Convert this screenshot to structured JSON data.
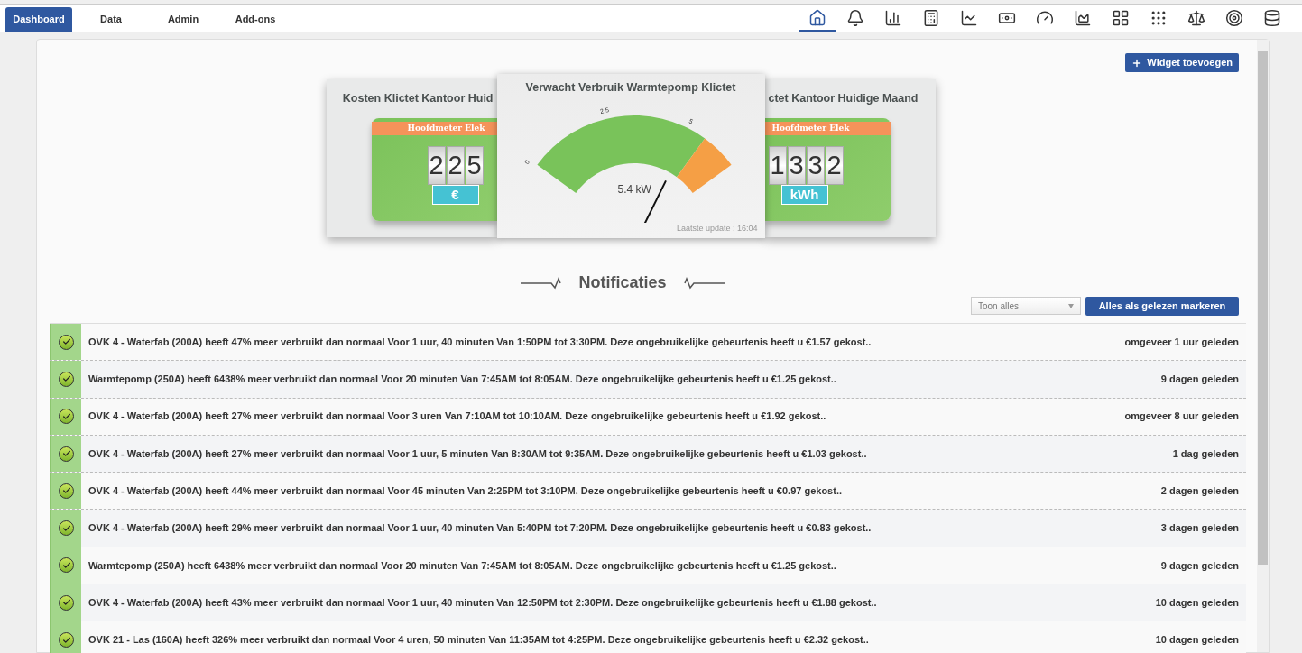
{
  "tabs": [
    {
      "label": "Dashboard",
      "selected": true
    },
    {
      "label": "Data",
      "selected": false
    },
    {
      "label": "Admin",
      "selected": false
    },
    {
      "label": "Add-ons",
      "selected": false
    }
  ],
  "toolbar": [
    {
      "selected": true
    },
    {
      "selected": false
    },
    {
      "selected": false
    },
    {
      "selected": false
    },
    {
      "selected": false
    },
    {
      "selected": false
    },
    {
      "selected": false
    },
    {
      "selected": false
    },
    {
      "selected": false
    },
    {
      "selected": false
    },
    {
      "selected": false
    },
    {
      "selected": false
    },
    {
      "selected": false
    }
  ],
  "add_widget_button": "Widget toevoegen",
  "widgets": [
    {
      "kind": "counter",
      "title": "Kosten Klictet Kantoor Huid",
      "meter": "Hoofdmeter Elek",
      "digits": [
        "2",
        "2",
        "5"
      ],
      "unit": "€"
    },
    {
      "kind": "gauge",
      "title": "Verwacht Verbruik Warmtepomp Klictet",
      "ticks": [
        "0",
        "2.5",
        "5"
      ],
      "value": "5.4 kW",
      "updated": "Laatste update : 16:04"
    },
    {
      "kind": "counter",
      "title": "ctet Kantoor Huidige Maand",
      "meter": "Hoofdmeter Elek",
      "digits": [
        "1",
        "3",
        "3",
        "2"
      ],
      "unit": "kWh"
    }
  ],
  "notifications": {
    "title": "Notificaties",
    "filter": "Toon alles",
    "mark_all_button": "Alles als gelezen markeren",
    "items": [
      {
        "message": "OVK 4 - Waterfab (200A) heeft 47% meer verbruikt dan normaal Voor 1 uur, 40 minuten Van 1:50PM tot 3:30PM. Deze ongebruikelijke gebeurtenis heeft u €1.57 gekost..",
        "time": "omgeveer 1 uur geleden"
      },
      {
        "message": "Warmtepomp (250A) heeft 6438% meer verbruikt dan normaal Voor 20 minuten Van 7:45AM tot 8:05AM. Deze ongebruikelijke gebeurtenis heeft u €1.25 gekost..",
        "time": "9 dagen geleden"
      },
      {
        "message": "OVK 4 - Waterfab (200A) heeft 27% meer verbruikt dan normaal Voor 3 uren Van 7:10AM tot 10:10AM. Deze ongebruikelijke gebeurtenis heeft u €1.92 gekost..",
        "time": "omgeveer 8 uur geleden"
      },
      {
        "message": "OVK 4 - Waterfab (200A) heeft 27% meer verbruikt dan normaal Voor 1 uur, 5 minuten Van 8:30AM tot 9:35AM. Deze ongebruikelijke gebeurtenis heeft u €1.03 gekost..",
        "time": "1 dag geleden"
      },
      {
        "message": "OVK 4 - Waterfab (200A) heeft 44% meer verbruikt dan normaal Voor 45 minuten Van 2:25PM tot 3:10PM. Deze ongebruikelijke gebeurtenis heeft u €0.97 gekost..",
        "time": "2 dagen geleden"
      },
      {
        "message": "OVK 4 - Waterfab (200A) heeft 29% meer verbruikt dan normaal Voor 1 uur, 40 minuten Van 5:40PM tot 7:20PM. Deze ongebruikelijke gebeurtenis heeft u €0.83 gekost..",
        "time": "3 dagen geleden"
      },
      {
        "message": "Warmtepomp (250A) heeft 6438% meer verbruikt dan normaal Voor 20 minuten Van 7:45AM tot 8:05AM. Deze ongebruikelijke gebeurtenis heeft u €1.25 gekost..",
        "time": "9 dagen geleden"
      },
      {
        "message": "OVK 4 - Waterfab (200A) heeft 43% meer verbruikt dan normaal Voor 1 uur, 40 minuten Van 12:50PM tot 2:30PM. Deze ongebruikelijke gebeurtenis heeft u €1.88 gekost..",
        "time": "10 dagen geleden"
      },
      {
        "message": "OVK 21 - Las (160A) heeft 326% meer verbruikt dan normaal Voor 4 uren, 50 minuten Van 11:35AM tot 4:25PM. Deze ongebruikelijke gebeurtenis heeft u €2.32 gekost..",
        "time": "10 dagen geleden"
      }
    ]
  }
}
